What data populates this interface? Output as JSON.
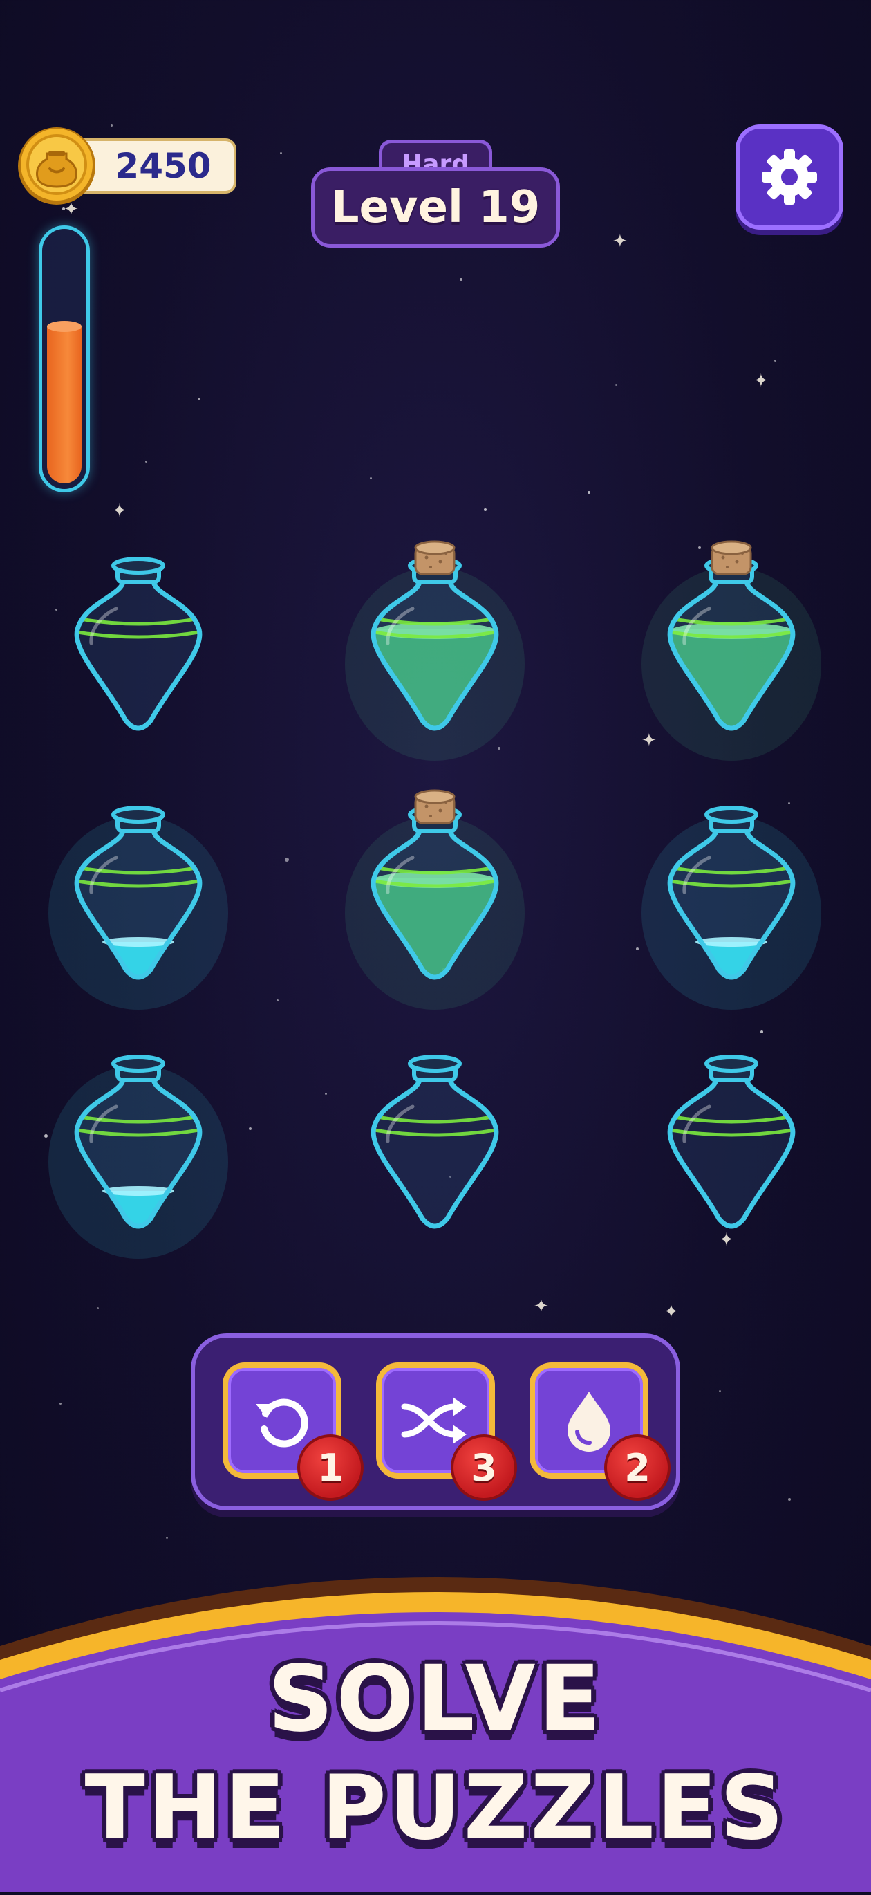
{
  "hud": {
    "coins": "2450",
    "difficulty": "Hard",
    "level": "Level 19",
    "progress_fraction": 0.63
  },
  "bottles": [
    {
      "id": 1,
      "corked": false,
      "fill": "empty",
      "liquid_color": ""
    },
    {
      "id": 2,
      "corked": true,
      "fill": "full",
      "liquid_color": "#49c98a"
    },
    {
      "id": 3,
      "corked": true,
      "fill": "full",
      "liquid_color": "#49c98a"
    },
    {
      "id": 4,
      "corked": false,
      "fill": "bottom",
      "liquid_color": "#36dcef"
    },
    {
      "id": 5,
      "corked": true,
      "fill": "full",
      "liquid_color": "#49c98a"
    },
    {
      "id": 6,
      "corked": false,
      "fill": "bottom",
      "liquid_color": "#36dcef"
    },
    {
      "id": 7,
      "corked": false,
      "fill": "bottom",
      "liquid_color": "#36dcef"
    },
    {
      "id": 8,
      "corked": false,
      "fill": "empty",
      "liquid_color": ""
    },
    {
      "id": 9,
      "corked": false,
      "fill": "empty",
      "liquid_color": ""
    }
  ],
  "boosters": [
    {
      "name": "undo",
      "icon": "undo-icon",
      "count": "1"
    },
    {
      "name": "shuffle",
      "icon": "shuffle-icon",
      "count": "3"
    },
    {
      "name": "drop",
      "icon": "drop-icon",
      "count": "2"
    }
  ],
  "banner": {
    "line1": "SOLVE",
    "line2": "THE PUZZLES"
  },
  "colors": {
    "background": "#120e2b",
    "bottle_glass": "#3fc9e8",
    "bottle_band": "#7bea3e",
    "panel": "#3b1f72",
    "booster_border": "#f4b93a",
    "badge_red": "#d9262b",
    "banner_purple": "#7a3ec4",
    "banner_gold": "#f6b52a",
    "progress_orange": "#f0782a"
  }
}
